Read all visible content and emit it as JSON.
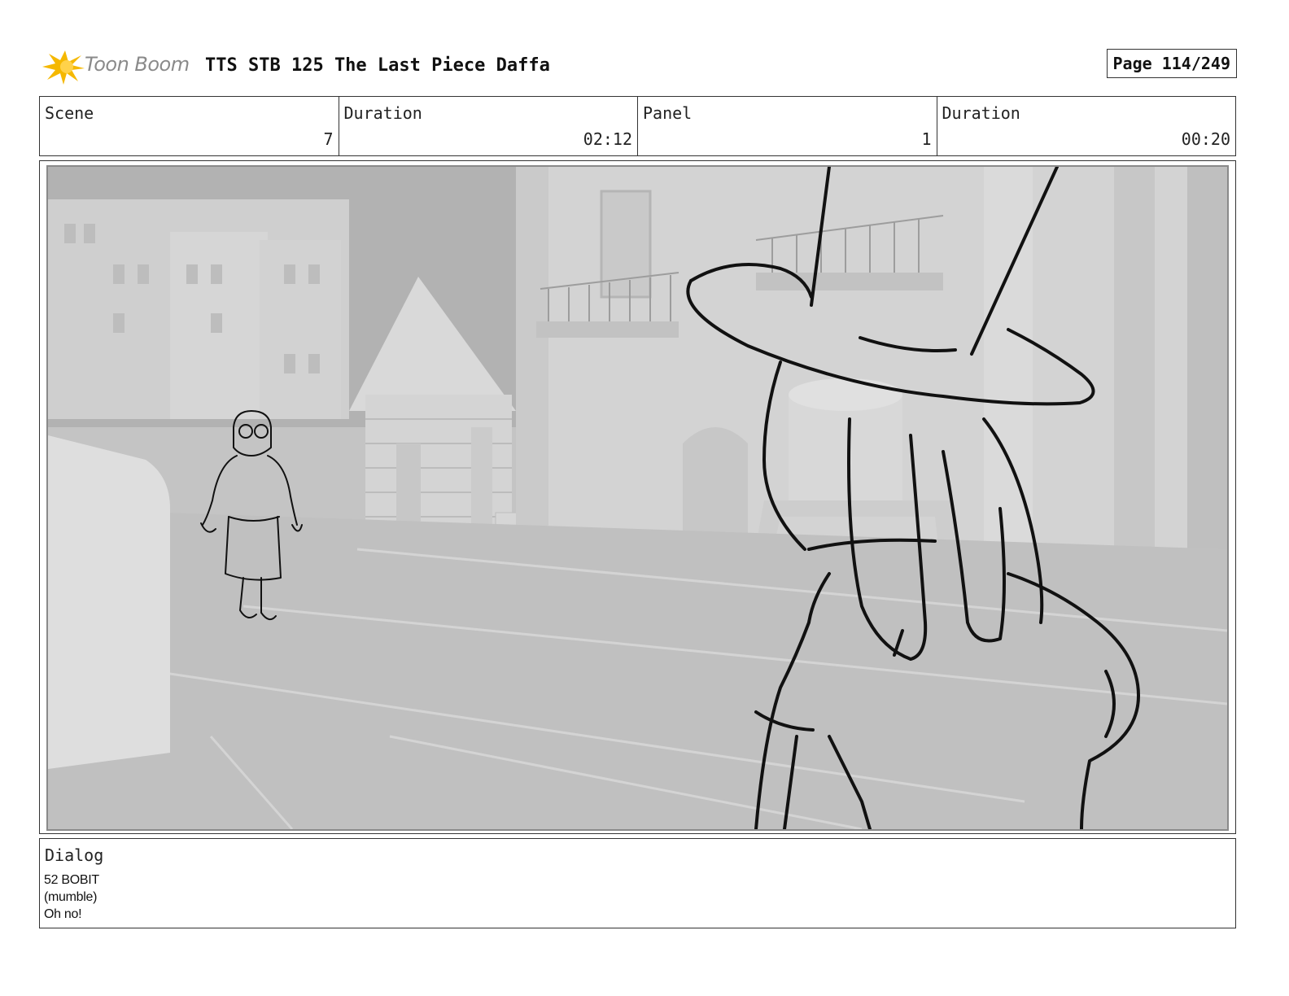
{
  "header": {
    "logo_text": "Toon Boom",
    "title": "TTS STB 125 The Last Piece Daffa",
    "page": "Page 114/249"
  },
  "info": {
    "scene_label": "Scene",
    "scene_value": "7",
    "scene_duration_label": "Duration",
    "scene_duration_value": "02:12",
    "panel_label": "Panel",
    "panel_value": "1",
    "panel_duration_label": "Duration",
    "panel_duration_value": "00:20"
  },
  "dialog": {
    "label": "Dialog",
    "lines": [
      "52 BOBIT",
      "(mumble)",
      "Oh no!"
    ]
  },
  "colors": {
    "logo_accent": "#f5b800",
    "sketch_line": "#111111",
    "background_render": "#c9c9c9"
  }
}
